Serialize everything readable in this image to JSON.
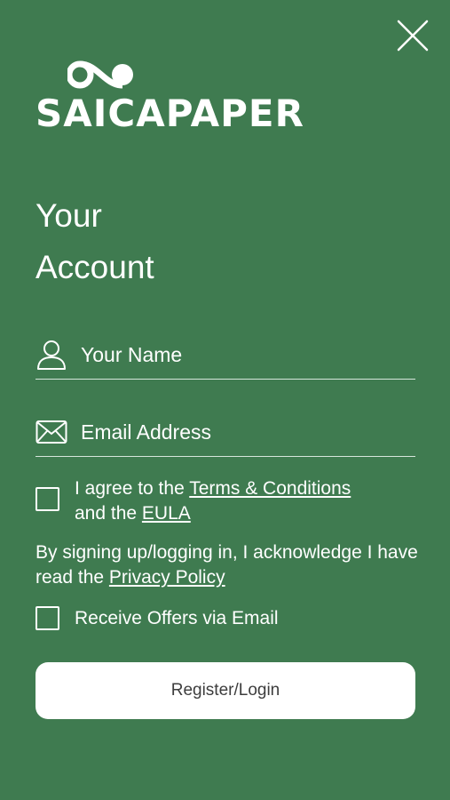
{
  "app": {
    "close_icon": "close-icon",
    "logo_text": "SAICAPAPER"
  },
  "header": {
    "title_line1": "Your",
    "title_line2": "Account"
  },
  "form": {
    "name_placeholder": "Your Name",
    "name_icon": "person-icon",
    "email_placeholder": "Email Address",
    "email_icon": "envelope-icon",
    "terms": {
      "prefix": "I agree to the ",
      "terms_link": "Terms & Conditions",
      "middle": "and the ",
      "eula_link": "EULA",
      "checked": false
    },
    "acknowledge": {
      "text": "By signing up/logging in, I acknowledge I have read the ",
      "privacy_link": "Privacy Policy"
    },
    "offers": {
      "label": "Receive Offers via Email",
      "checked": false
    },
    "submit_label": "Register/Login"
  },
  "colors": {
    "background": "#3f7b50",
    "text": "#ffffff",
    "button_bg": "#ffffff",
    "button_text": "#3d3d3d"
  }
}
